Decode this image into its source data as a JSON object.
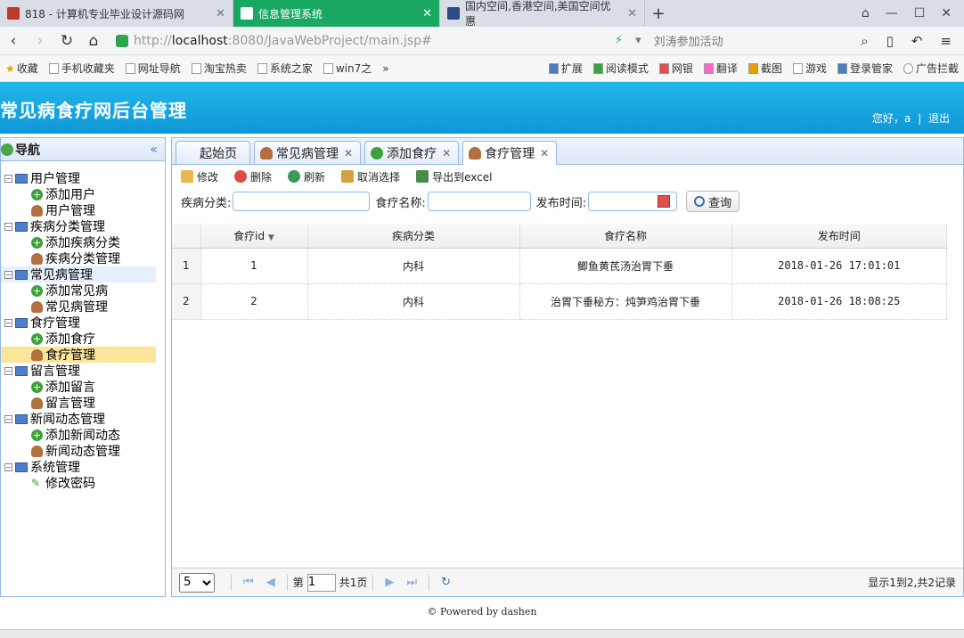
{
  "browser": {
    "tabs": [
      {
        "label": "818 - 计算机专业毕业设计源码网",
        "active": false
      },
      {
        "label": "信息管理系统",
        "active": true
      },
      {
        "label": "国内空间,香港空间,美国空间优惠",
        "active": false
      }
    ],
    "url_scheme": "http://",
    "url_host": "localhost",
    "url_path": ":8080/JavaWebProject/main.jsp#",
    "promo": "刘涛参加活动"
  },
  "bookmarks": {
    "left": [
      "收藏",
      "手机收藏夹",
      "网址导航",
      "淘宝热卖",
      "系统之家",
      "win7之"
    ],
    "right": [
      "扩展",
      "阅读模式",
      "网银",
      "翻译",
      "截图",
      "游戏",
      "登录管家",
      "广告拦截"
    ]
  },
  "banner": {
    "title": "常见病食疗网后台管理",
    "greeting": "您好，a",
    "logout": "退出"
  },
  "sidebar": {
    "title": "导航",
    "groups": [
      {
        "label": "用户管理",
        "children": [
          {
            "label": "添加用户",
            "icon": "add"
          },
          {
            "label": "用户管理",
            "icon": "user"
          }
        ]
      },
      {
        "label": "疾病分类管理",
        "children": [
          {
            "label": "添加疾病分类",
            "icon": "add"
          },
          {
            "label": "疾病分类管理",
            "icon": "user"
          }
        ]
      },
      {
        "label": "常见病管理",
        "children": [
          {
            "label": "添加常见病",
            "icon": "add"
          },
          {
            "label": "常见病管理",
            "icon": "user"
          }
        ]
      },
      {
        "label": "食疗管理",
        "children": [
          {
            "label": "添加食疗",
            "icon": "add"
          },
          {
            "label": "食疗管理",
            "icon": "user"
          }
        ]
      },
      {
        "label": "留言管理",
        "children": [
          {
            "label": "添加留言",
            "icon": "add"
          },
          {
            "label": "留言管理",
            "icon": "user"
          }
        ]
      },
      {
        "label": "新闻动态管理",
        "children": [
          {
            "label": "添加新闻动态",
            "icon": "add"
          },
          {
            "label": "新闻动态管理",
            "icon": "user"
          }
        ]
      },
      {
        "label": "系统管理",
        "children": [
          {
            "label": "修改密码",
            "icon": "pencil"
          }
        ]
      }
    ]
  },
  "tabs": [
    {
      "label": "起始页",
      "closable": false
    },
    {
      "label": "常见病管理",
      "closable": true
    },
    {
      "label": "添加食疗",
      "closable": true
    },
    {
      "label": "食疗管理",
      "closable": true,
      "active": true
    }
  ],
  "toolbar": {
    "edit": "修改",
    "delete": "删除",
    "refresh": "刷新",
    "cancel_select": "取消选择",
    "export": "导出到excel"
  },
  "filters": {
    "category_label": "疾病分类:",
    "name_label": "食疗名称:",
    "date_label": "发布时间:",
    "query": "查询"
  },
  "grid": {
    "columns": [
      "食疗id",
      "疾病分类",
      "食疗名称",
      "发布时间"
    ],
    "rows": [
      {
        "rn": "1",
        "id": "1",
        "category": "内科",
        "name": "鲫鱼黄芪汤治胃下垂",
        "date": "2018-01-26 17:01:01"
      },
      {
        "rn": "2",
        "id": "2",
        "category": "内科",
        "name": "治胃下垂秘方：炖笋鸡治胃下垂",
        "date": "2018-01-26 18:08:25"
      }
    ]
  },
  "pager": {
    "page_size": "5",
    "page_prefix": "第",
    "page_value": "1",
    "page_suffix": "共1页",
    "info": "显示1到2,共2记录"
  },
  "footer": "© Powered by dashen"
}
